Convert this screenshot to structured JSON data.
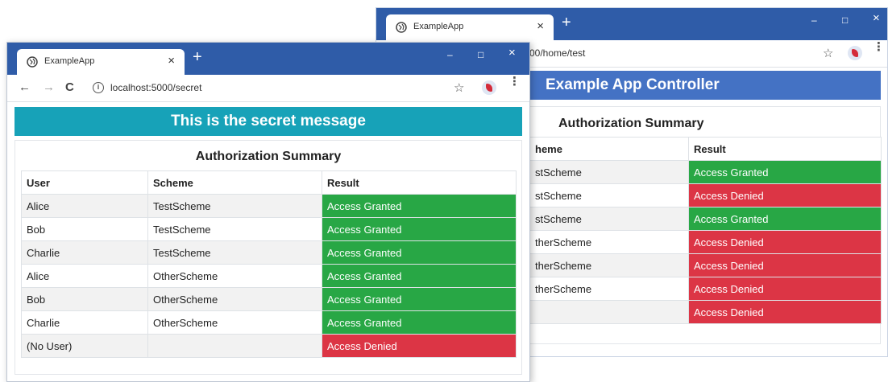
{
  "colors": {
    "titlebar": "#2f5ca8",
    "secret_banner": "#17a2b8",
    "controller_banner": "#4472c4",
    "granted": "#28a745",
    "denied": "#dc3545"
  },
  "back_window": {
    "tab_title": "ExampleApp",
    "tab_close": "×",
    "new_tab": "+",
    "minimize": "–",
    "maximize": "□",
    "close": "×",
    "url": "00/home/test",
    "banner": "Example App Controller",
    "summary_title": "Authorization Summary",
    "columns": [
      "heme",
      "Result"
    ],
    "rows": [
      {
        "scheme": "stScheme",
        "result": "Access Granted",
        "status": "granted"
      },
      {
        "scheme": "stScheme",
        "result": "Access Denied",
        "status": "denied"
      },
      {
        "scheme": "stScheme",
        "result": "Access Granted",
        "status": "granted"
      },
      {
        "scheme": "therScheme",
        "result": "Access Denied",
        "status": "denied"
      },
      {
        "scheme": "therScheme",
        "result": "Access Denied",
        "status": "denied"
      },
      {
        "scheme": "therScheme",
        "result": "Access Denied",
        "status": "denied"
      },
      {
        "scheme": "",
        "result": "Access Denied",
        "status": "denied"
      }
    ]
  },
  "front_window": {
    "tab_title": "ExampleApp",
    "tab_close": "×",
    "new_tab": "+",
    "minimize": "–",
    "maximize": "□",
    "close": "×",
    "back": "←",
    "forward": "→",
    "reload": "C",
    "info": "i",
    "url": "localhost:5000/secret",
    "star": "☆",
    "menu": "⋮",
    "banner": "This is the secret message",
    "summary_title": "Authorization Summary",
    "columns": [
      "User",
      "Scheme",
      "Result"
    ],
    "rows": [
      {
        "user": "Alice",
        "scheme": "TestScheme",
        "result": "Access Granted",
        "status": "granted"
      },
      {
        "user": "Bob",
        "scheme": "TestScheme",
        "result": "Access Granted",
        "status": "granted"
      },
      {
        "user": "Charlie",
        "scheme": "TestScheme",
        "result": "Access Granted",
        "status": "granted"
      },
      {
        "user": "Alice",
        "scheme": "OtherScheme",
        "result": "Access Granted",
        "status": "granted"
      },
      {
        "user": "Bob",
        "scheme": "OtherScheme",
        "result": "Access Granted",
        "status": "granted"
      },
      {
        "user": "Charlie",
        "scheme": "OtherScheme",
        "result": "Access Granted",
        "status": "granted"
      },
      {
        "user": "(No User)",
        "scheme": "",
        "result": "Access Denied",
        "status": "denied"
      }
    ]
  }
}
